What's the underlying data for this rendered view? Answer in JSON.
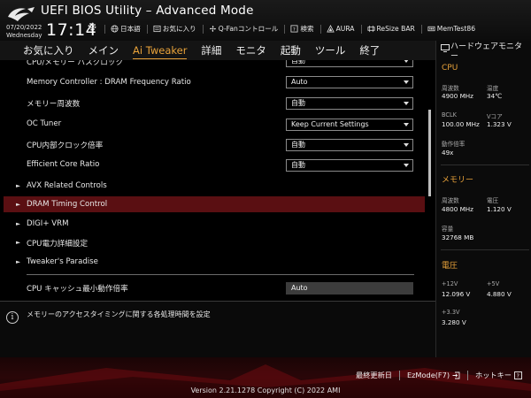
{
  "header": {
    "title": "UEFI BIOS Utility – Advanced Mode",
    "date": "07/20/2022",
    "weekday": "Wednesday",
    "time": "17:14",
    "toolbar": [
      {
        "icon": "globe-icon",
        "label": "日本語"
      },
      {
        "icon": "favorites-icon",
        "label": "お気に入り"
      },
      {
        "icon": "fan-icon",
        "label": "Q-Fanコントロール"
      },
      {
        "icon": "search-help-icon",
        "label": "検索"
      },
      {
        "icon": "aura-icon",
        "label": "AURA"
      },
      {
        "icon": "resize-bar-icon",
        "label": "ReSize BAR"
      },
      {
        "icon": "memtest-icon",
        "label": "MemTest86"
      }
    ]
  },
  "menu": [
    {
      "label": "お気に入り",
      "active": false
    },
    {
      "label": "メイン",
      "active": false
    },
    {
      "label": "Ai Tweaker",
      "active": true
    },
    {
      "label": "詳細",
      "active": false
    },
    {
      "label": "モニタ",
      "active": false
    },
    {
      "label": "起動",
      "active": false
    },
    {
      "label": "ツール",
      "active": false
    },
    {
      "label": "終了",
      "active": false
    }
  ],
  "settings": {
    "partial_row": {
      "label": "CPU/メモリー バスクロック",
      "value": "自動"
    },
    "memory_controller": {
      "label": "Memory Controller : DRAM Frequency Ratio",
      "value": "Auto"
    },
    "memory_frequency": {
      "label": "メモリー周波数",
      "value": "自動"
    },
    "oc_tuner": {
      "label": "OC Tuner",
      "value": "Keep Current Settings"
    },
    "cpu_core_ratio": {
      "label": "CPU内部クロック倍率",
      "value": "自動"
    },
    "efficient_core_ratio": {
      "label": "Efficient Core Ratio",
      "value": "自動"
    },
    "avx": {
      "label": "AVX Related Controls"
    },
    "dram_timing": {
      "label": "DRAM Timing Control"
    },
    "digi_vrm": {
      "label": "DIGI+ VRM"
    },
    "cpu_power": {
      "label": "CPU電力詳細設定"
    },
    "tweakers_paradise": {
      "label": "Tweaker's Paradise"
    },
    "cpu_cache_min": {
      "label": "CPU キャッシュ最小動作倍率",
      "value": "Auto"
    }
  },
  "info": {
    "text": "メモリーのアクセスタイミングに関する各処理時間を設定"
  },
  "hardware_monitor": {
    "title": "ハードウェアモニター",
    "cpu": {
      "title": "CPU",
      "frequency_label": "周波数",
      "frequency": "4900 MHz",
      "temperature_label": "温度",
      "temperature": "34℃",
      "bclk_label": "BCLK",
      "bclk": "100.00 MHz",
      "vcore_label": "Vコア",
      "vcore": "1.323 V",
      "ratio_label": "動作倍率",
      "ratio": "49x"
    },
    "memory": {
      "title": "メモリー",
      "frequency_label": "周波数",
      "frequency": "4800 MHz",
      "voltage_label": "電圧",
      "voltage": "1.120 V",
      "capacity_label": "容量",
      "capacity": "32768 MB"
    },
    "voltage": {
      "title": "電圧",
      "v12_label": "+12V",
      "v12": "12.096 V",
      "v5_label": "+5V",
      "v5": "4.880 V",
      "v33_label": "+3.3V",
      "v33": "3.280 V"
    }
  },
  "footer": {
    "last_modified": "最終更新日",
    "ezmode": "EzMode(F7)",
    "hotkeys": "ホットキー",
    "copyright": "Version 2.21.1278 Copyright (C) 2022 AMI"
  },
  "colors": {
    "accent": "#e8a23a",
    "highlight_row": "#5a0f12",
    "footer_red": "#b3141c"
  }
}
